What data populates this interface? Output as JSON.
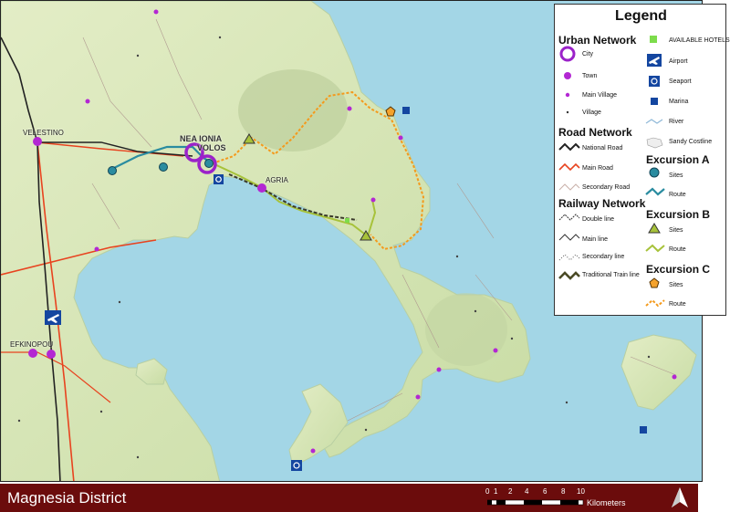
{
  "legend": {
    "title": "Legend",
    "urban_network": {
      "title": "Urban Network",
      "items": [
        "City",
        "Town",
        "Main Village",
        "Village"
      ]
    },
    "road_network": {
      "title": "Road Network",
      "items": [
        "National Road",
        "Main Road",
        "Secondary Road"
      ]
    },
    "railway_network": {
      "title": "Railway Network",
      "items": [
        "Double line",
        "Main line",
        "Secondary line",
        "Traditional Train line"
      ]
    },
    "other_items": [
      "AVAILABLE HOTELS",
      "Airport",
      "Seaport",
      "Marina",
      "River",
      "Sandy Costline"
    ],
    "excursion_a": {
      "title": "Excursion A",
      "items": [
        "Sites",
        "Route"
      ]
    },
    "excursion_b": {
      "title": "Excursion B",
      "items": [
        "Sites",
        "Route"
      ]
    },
    "excursion_c": {
      "title": "Excursion C",
      "items": [
        "Sites",
        "Route"
      ]
    }
  },
  "map_labels": {
    "nea_ionia": "NEA IONIA",
    "volos": "VOLOS",
    "velestino": "VELESTINO",
    "efkinopou": "EFKINOPOU",
    "agria": "AGRIA"
  },
  "footer": {
    "title": "Magnesia District",
    "scale_ticks": [
      "0",
      "1",
      "2",
      "4",
      "6",
      "8",
      "10"
    ],
    "scale_unit": "Kilometers"
  },
  "colors": {
    "sea": "#a3d6e6",
    "land": "#d5e6b4",
    "footer": "#6b0c0c",
    "urban": "#9b22c9",
    "main_road": "#e8431f",
    "route_a": "#2a8ca0",
    "route_b": "#a7c23a",
    "route_c": "#f49a1c"
  }
}
